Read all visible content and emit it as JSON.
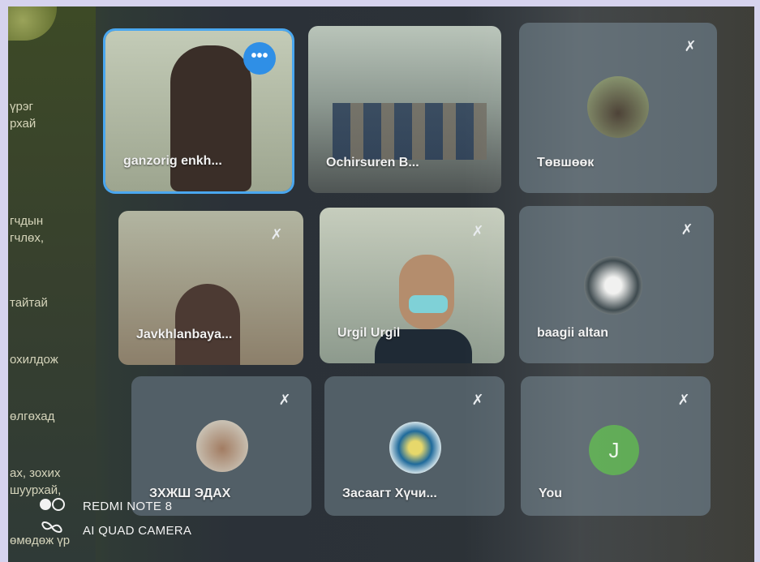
{
  "left_panel": {
    "lines": [
      "үрэг\nрхай",
      "гчдын\nгчлөх,",
      "тайтай",
      "охилдож",
      "өлгөхад",
      "ах, зохих\nшуурхай,",
      "өмөдөж үр"
    ]
  },
  "participants": [
    {
      "name": "ganzorig enkh...",
      "muted": false,
      "more_menu": true,
      "type": "video"
    },
    {
      "name": "Ochirsuren B...",
      "muted": false,
      "more_menu": false,
      "type": "video"
    },
    {
      "name": "Төвшөөк",
      "muted": true,
      "more_menu": false,
      "type": "avatar"
    },
    {
      "name": "Javkhlanbaya...",
      "muted": true,
      "more_menu": false,
      "type": "video"
    },
    {
      "name": "Urgil Urgil",
      "muted": true,
      "more_menu": false,
      "type": "video"
    },
    {
      "name": "baagii altan",
      "muted": true,
      "more_menu": false,
      "type": "avatar"
    },
    {
      "name": "ЗХЖШ ЭДАХ",
      "muted": true,
      "more_menu": false,
      "type": "avatar"
    },
    {
      "name": "Засаагт Хүчи...",
      "muted": true,
      "more_menu": false,
      "type": "avatar"
    },
    {
      "name": "You",
      "muted": true,
      "more_menu": false,
      "type": "initial",
      "initial": "J"
    }
  ],
  "icons": {
    "mic_off": "mic-off-icon",
    "more": "more-options-icon",
    "camera": "dual-camera-icon"
  },
  "watermark": {
    "line1": "REDMI NOTE 8",
    "line2": "AI QUAD CAMERA"
  },
  "colors": {
    "active_border": "#4aa7ef",
    "more_button": "#2f8fe6",
    "initial_avatar": "#52a447"
  }
}
